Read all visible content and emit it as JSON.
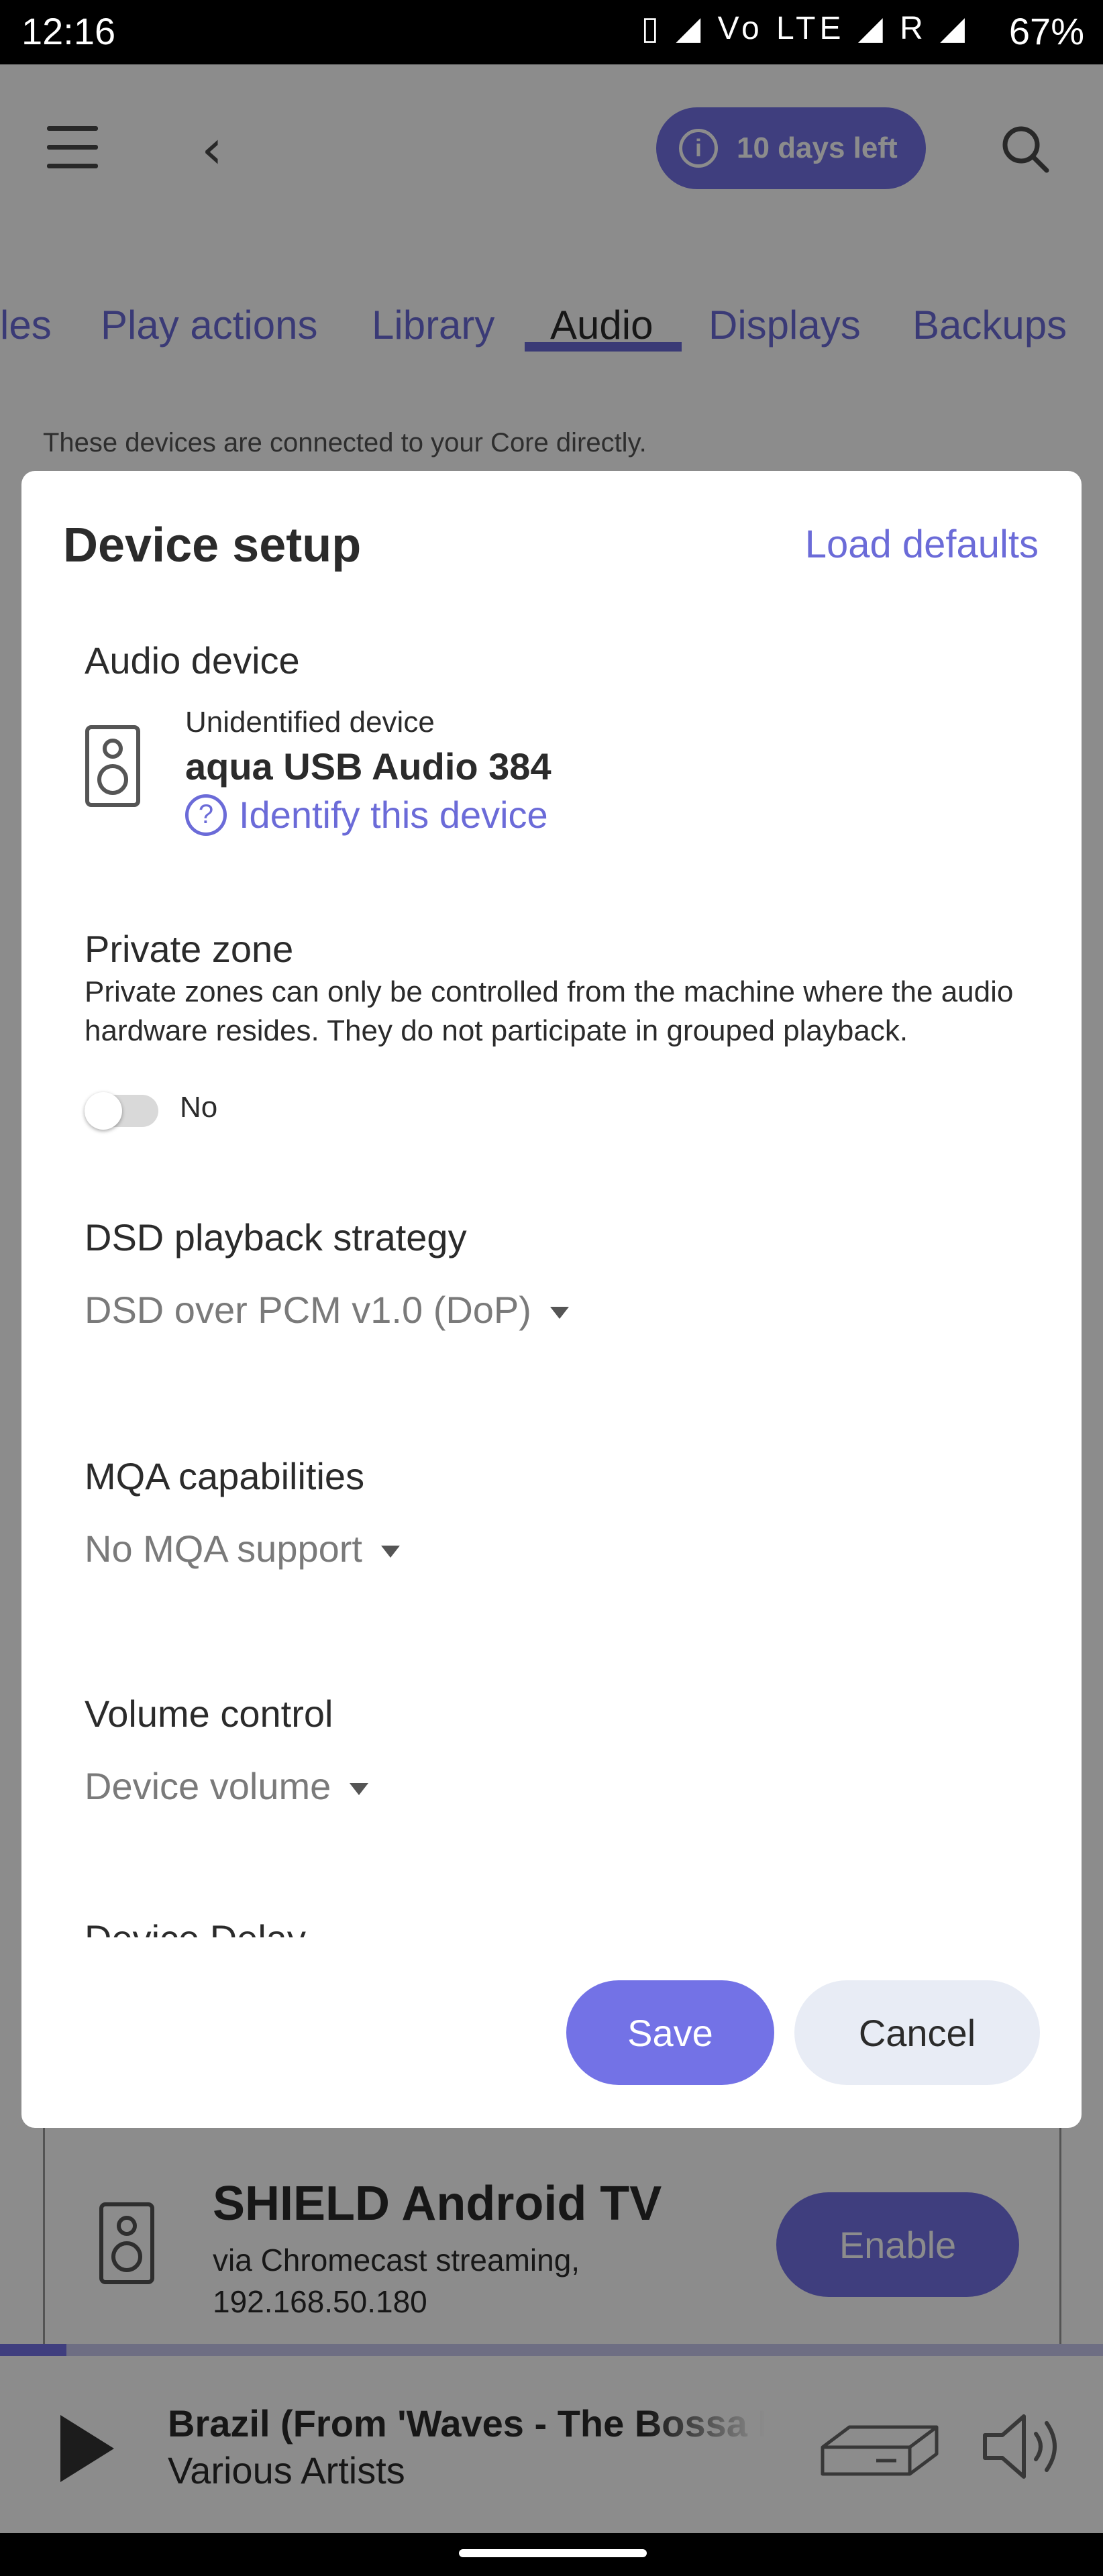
{
  "status_bar": {
    "time": "12:16",
    "indicators": "▯ ◢ Vo LTE ◢ R ◢",
    "battery": "67%"
  },
  "app_bar": {
    "trial_label": "10 days left",
    "tabs": [
      {
        "label": "les"
      },
      {
        "label": "Play actions"
      },
      {
        "label": "Library"
      },
      {
        "label": "Audio"
      },
      {
        "label": "Displays"
      },
      {
        "label": "Backups"
      }
    ],
    "active_tab": "Audio",
    "section_hint": "These devices are connected to your Core directly."
  },
  "dialog": {
    "title": "Device setup",
    "load_defaults": "Load defaults",
    "audio_device": {
      "label": "Audio device",
      "subtitle": "Unidentified device",
      "name": "aqua USB Audio 384",
      "identify_link": "Identify this device"
    },
    "private_zone": {
      "label": "Private zone",
      "description": "Private zones can only be controlled from the machine where the audio hardware resides. They do not participate in grouped playback.",
      "toggle_value": "No"
    },
    "dsd": {
      "label": "DSD playback strategy",
      "value": "DSD over PCM v1.0 (DoP)"
    },
    "mqa": {
      "label": "MQA capabilities",
      "value": "No MQA support"
    },
    "volume": {
      "label": "Volume control",
      "value": "Device volume"
    },
    "cut_off_label": "Device Delay",
    "save_label": "Save",
    "cancel_label": "Cancel"
  },
  "device_card": {
    "name": "SHIELD Android TV",
    "via": "via Chromecast streaming, 192.168.50.180",
    "enable_label": "Enable"
  },
  "player": {
    "track": "Brazil (From 'Waves - The Bossa Nova",
    "artist": "Various Artists",
    "progress": 0.06
  },
  "colors": {
    "accent": "#7372e6",
    "link": "#6b6bd8"
  }
}
